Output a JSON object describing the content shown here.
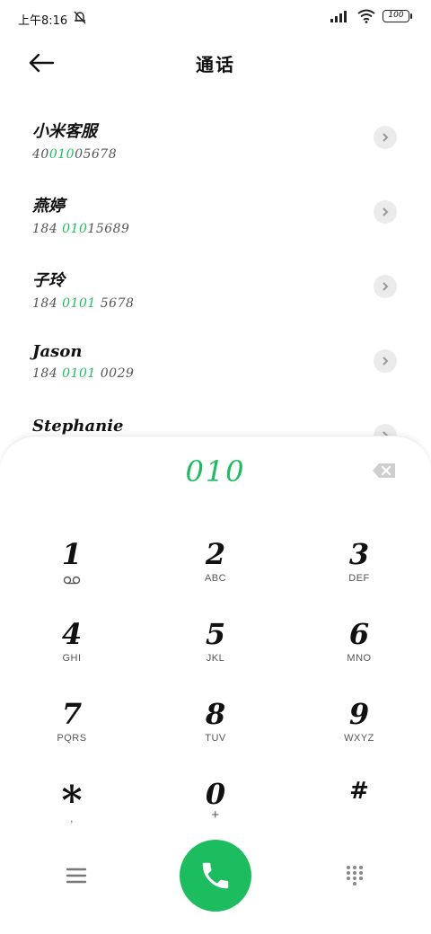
{
  "status": {
    "time": "上午8:16",
    "battery": "100"
  },
  "header": {
    "title": "通话"
  },
  "contacts": [
    {
      "name": "小米客服",
      "num_pre": "40",
      "num_hl": "010",
      "num_post": "05678"
    },
    {
      "name": "燕婷",
      "num_pre": "184 ",
      "num_hl": "010",
      "num_post": "15689"
    },
    {
      "name": "子玲",
      "num_pre": "184 ",
      "num_hl": "0101",
      "num_post": " 5678"
    },
    {
      "name": "Jason",
      "num_pre": "184 ",
      "num_hl": "0101",
      "num_post": " 0029"
    },
    {
      "name": "Stephanie",
      "num_pre": "",
      "num_hl": "",
      "num_post": ""
    }
  ],
  "dialer": {
    "entry": "010"
  },
  "keys": [
    {
      "digit": "1",
      "letters": ""
    },
    {
      "digit": "2",
      "letters": "ABC"
    },
    {
      "digit": "3",
      "letters": "DEF"
    },
    {
      "digit": "4",
      "letters": "GHI"
    },
    {
      "digit": "5",
      "letters": "JKL"
    },
    {
      "digit": "6",
      "letters": "MNO"
    },
    {
      "digit": "7",
      "letters": "PQRS"
    },
    {
      "digit": "8",
      "letters": "TUV"
    },
    {
      "digit": "9",
      "letters": "WXYZ"
    },
    {
      "digit": "*",
      "letters": ","
    },
    {
      "digit": "0",
      "letters": "+"
    },
    {
      "digit": "#",
      "letters": ""
    }
  ],
  "colors": {
    "accent": "#1bbd5f"
  },
  "icons": {
    "back": "back-arrow-icon",
    "backspace": "backspace-icon",
    "voicemail": "voicemail-icon",
    "menu": "menu-icon",
    "call": "phone-icon",
    "dialpad": "dialpad-icon"
  }
}
